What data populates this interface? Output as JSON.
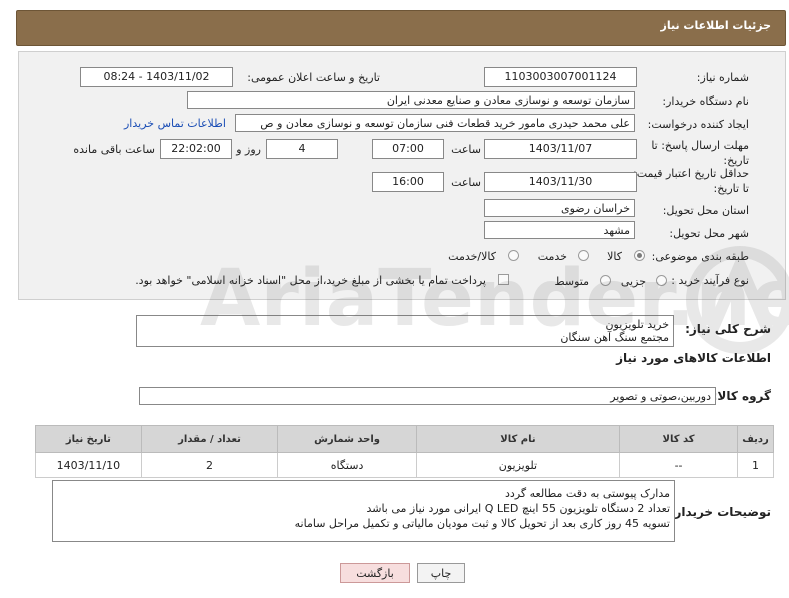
{
  "header": {
    "title": "جزئیات اطلاعات نیاز"
  },
  "form": {
    "need_number": {
      "label": "شماره نیاز:",
      "value": "1103003007001124"
    },
    "announce_datetime": {
      "label": "تاریخ و ساعت اعلان عمومی:",
      "value": "1403/11/02 - 08:24"
    },
    "buyer_org": {
      "label": "نام دستگاه خریدار:",
      "value": "سازمان توسعه و نوسازی معادن و صنایع معدنی ایران"
    },
    "requester": {
      "label": "ایجاد کننده درخواست:",
      "value": "علی محمد حیدری مامور خرید قطعات فنی سازمان توسعه و نوسازی معادن و ص",
      "contact_link": "اطلاعات تماس خریدار"
    },
    "reply_deadline": {
      "label": "مهلت ارسال پاسخ: تا تاریخ:",
      "date": "1403/11/07",
      "time_label": "ساعت",
      "time": "07:00",
      "days": "4",
      "days_label": "روز و",
      "remaining": "22:02:00",
      "remaining_label": "ساعت باقی مانده"
    },
    "price_validity": {
      "label": "حداقل تاریخ اعتبار قیمت: تا تاریخ:",
      "date": "1403/11/30",
      "time_label": "ساعت",
      "time": "16:00"
    },
    "delivery_province": {
      "label": "استان محل تحویل:",
      "value": "خراسان رضوی"
    },
    "delivery_city": {
      "label": "شهر محل تحویل:",
      "value": "مشهد"
    },
    "category": {
      "label": "طبقه بندی موضوعی:",
      "options": [
        "کالا",
        "خدمت",
        "کالا/خدمت"
      ],
      "selected": "کالا"
    },
    "purchase_type": {
      "label": "نوع فرآیند خرید :",
      "options": [
        "جزیی",
        "متوسط"
      ],
      "payment_note": "پرداخت تمام یا بخشی از مبلغ خرید،از محل \"اسناد خزانه اسلامی\" خواهد بود."
    }
  },
  "description": {
    "label": "شرح کلی نیاز:",
    "lines": [
      "خرید تلویزیون",
      "مجتمع سنگ آهن سنگان"
    ]
  },
  "goods_section": {
    "title": "اطلاعات کالاهای مورد نیاز"
  },
  "goods_group": {
    "label": "گروه کالا:",
    "value": "دوربین،صوتی و تصویر"
  },
  "table": {
    "headers": [
      "ردیف",
      "کد کالا",
      "نام کالا",
      "واحد شمارش",
      "تعداد / مقدار",
      "تاریخ نیاز"
    ],
    "rows": [
      [
        "1",
        "--",
        "تلویزیون",
        "دستگاه",
        "2",
        "1403/11/10"
      ]
    ]
  },
  "buyer_notes": {
    "label": "توضیحات خریدار:",
    "lines": [
      "مدارک پیوستی به دقت مطالعه گردد",
      "تعداد 2 دستگاه تلویزیون 55 اینچ Q LED ایرانی مورد نیاز می باشد",
      "تسویه 45 روز کاری بعد از تحویل کالا و ثبت مودیان مالیاتی و تکمیل مراحل سامانه"
    ]
  },
  "buttons": {
    "print": "چاپ",
    "back": "بازگشت"
  },
  "watermark": {
    "text": "AriaTender.net"
  },
  "colors": {
    "header_bg": "#8a6e4b",
    "link": "#1a4db5",
    "back_button_bg": "#f7dede"
  }
}
